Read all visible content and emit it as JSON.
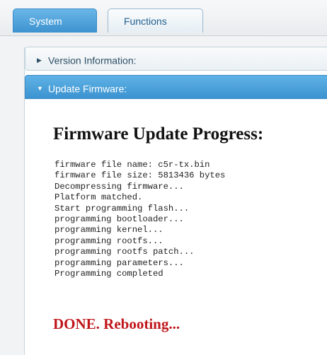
{
  "tabs": [
    {
      "label": "System"
    },
    {
      "label": "Functions"
    }
  ],
  "accordion": {
    "version": {
      "label": "Version Information:",
      "icon": "caret-right-icon"
    },
    "update": {
      "label": "Update Firmware:",
      "icon": "caret-down-icon"
    }
  },
  "firmware": {
    "title": "Firmware Update Progress:",
    "log": [
      "firmware file name: c5r-tx.bin",
      "firmware file size: 5813436 bytes",
      "Decompressing firmware...",
      "Platform matched.",
      "Start programming flash...",
      "programming bootloader...",
      "programming kernel...",
      "programming rootfs...",
      "programming rootfs patch...",
      "programming parameters...",
      "Programming completed"
    ],
    "status": "DONE. Rebooting..."
  },
  "colors": {
    "accent": "#3c93d0",
    "status": "#c0161b"
  }
}
